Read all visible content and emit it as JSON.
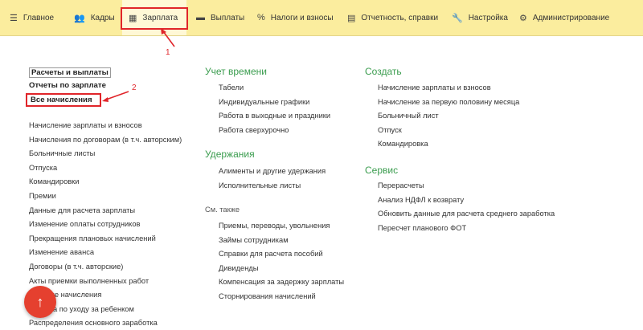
{
  "nav": {
    "items": [
      {
        "label": "Главное",
        "icon": "menu-icon",
        "glyph": "☰"
      },
      {
        "label": "Кадры",
        "icon": "people-icon",
        "glyph": "👥"
      },
      {
        "label": "Зарплата",
        "icon": "calculator-icon",
        "glyph": "▦"
      },
      {
        "label": "Выплаты",
        "icon": "payment-card-icon",
        "glyph": "▬"
      },
      {
        "label": "Налоги и взносы",
        "icon": "percent-icon",
        "glyph": "%"
      },
      {
        "label": "Отчетность, справки",
        "icon": "report-icon",
        "glyph": "▤"
      },
      {
        "label": "Настройка",
        "icon": "wrench-icon",
        "glyph": "🔧"
      },
      {
        "label": "Администрирование",
        "icon": "gear-icon",
        "glyph": "⚙"
      }
    ],
    "active": "Зарплата"
  },
  "annotations": {
    "one": "1",
    "two": "2"
  },
  "col1": {
    "bold": [
      "Расчеты и выплаты",
      "Отчеты по зарплате",
      "Все начисления"
    ],
    "links": [
      "Начисление зарплаты и взносов",
      "Начисления по договорам (в т.ч. авторским)",
      "Больничные листы",
      "Отпуска",
      "Командировки",
      "Премии",
      "Данные для расчета зарплаты",
      "Изменение оплаты сотрудников",
      "Прекращения плановых начислений",
      "Изменение аванса",
      "Договоры (в т.ч. авторские)",
      "Акты приемки выполненных работ",
      "Разовые начисления",
      "Отпуска по уходу за ребенком",
      "Распределения основного заработка"
    ]
  },
  "col2": {
    "time_heading": "Учет времени",
    "time_links": [
      "Табели",
      "Индивидуальные графики",
      "Работа в выходные и праздники",
      "Работа сверхурочно"
    ],
    "deduct_heading": "Удержания",
    "deduct_links": [
      "Алименты и другие удержания",
      "Исполнительные листы"
    ],
    "see_also": "См. также",
    "see_links": [
      "Приемы, переводы, увольнения",
      "Займы сотрудникам",
      "Справки для расчета пособий",
      "Дивиденды",
      "Компенсация за задержку зарплаты",
      "Сторнирования начислений"
    ]
  },
  "col3": {
    "create_heading": "Создать",
    "create_links": [
      "Начисление зарплаты и взносов",
      "Начисление за первую половину месяца",
      "Больничный лист",
      "Отпуск",
      "Командировка"
    ],
    "service_heading": "Сервис",
    "service_links": [
      "Перерасчеты",
      "Анализ НДФЛ к возврату",
      "Обновить данные для расчета среднего заработка",
      "Пересчет планового ФОТ"
    ]
  },
  "fab": {
    "icon": "arrow-up-icon",
    "glyph": "↑"
  }
}
